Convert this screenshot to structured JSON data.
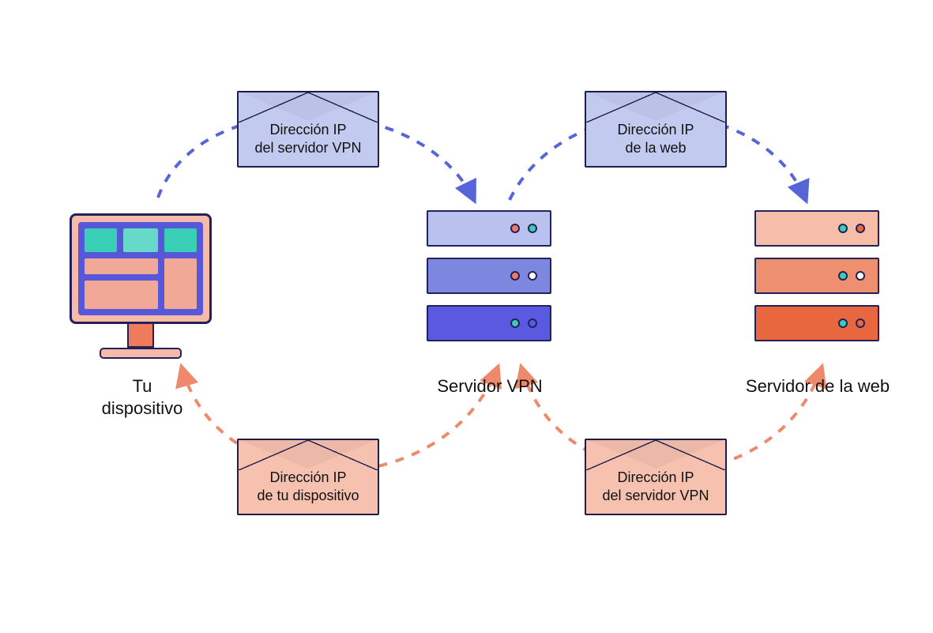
{
  "nodes": {
    "device_label": "Tu\ndispositivo",
    "vpn_label": "Servidor VPN",
    "web_label": "Servidor de la web"
  },
  "envelopes": {
    "top_left": "Dirección IP\ndel servidor VPN",
    "top_right": "Dirección IP\nde la web",
    "bottom_left": "Dirección IP\nde tu dispositivo",
    "bottom_right": "Dirección IP\ndel servidor VPN"
  }
}
